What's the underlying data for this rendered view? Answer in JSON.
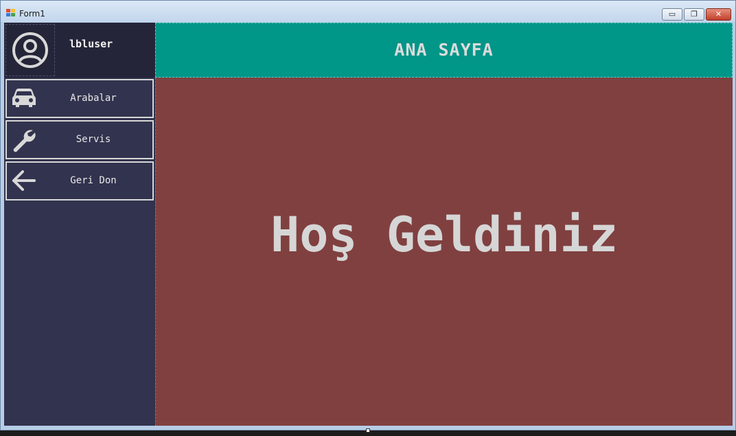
{
  "window": {
    "title": "Form1",
    "minimize_glyph": "▭",
    "maximize_glyph": "❐",
    "close_glyph": "✕"
  },
  "user": {
    "name": "lbluser",
    "icon": "user-circle-icon"
  },
  "nav": {
    "items": [
      {
        "label": "Arabalar",
        "icon": "car-icon"
      },
      {
        "label": "Servis",
        "icon": "wrench-icon"
      },
      {
        "label": "Geri Don",
        "icon": "arrow-left-icon"
      }
    ]
  },
  "header": {
    "title": "ANA SAYFA"
  },
  "main": {
    "welcome": "Hoş Geldiniz"
  },
  "colors": {
    "sidebar": "#32334e",
    "user_panel": "#252539",
    "header": "#009688",
    "content": "#804040",
    "text": "#d6d6d6"
  }
}
